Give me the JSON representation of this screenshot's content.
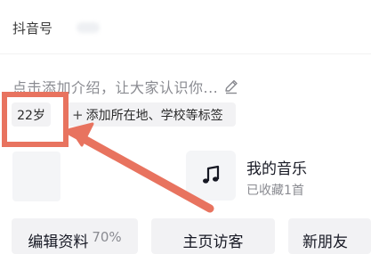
{
  "profile": {
    "douyin_id_label": "抖音号",
    "bio_placeholder": "点击添加介绍，让大家认识你..."
  },
  "tags": {
    "age": "22岁",
    "add_plus": "+",
    "add_location": "添加所在地、学校等标签"
  },
  "music": {
    "title": "我的音乐",
    "subtitle": "已收藏1首"
  },
  "actions": {
    "edit_profile": "编辑资料",
    "edit_progress": "70%",
    "visitors": "主页访客",
    "new_friends": "新朋友"
  },
  "annotation": {
    "color": "#e8735f"
  }
}
